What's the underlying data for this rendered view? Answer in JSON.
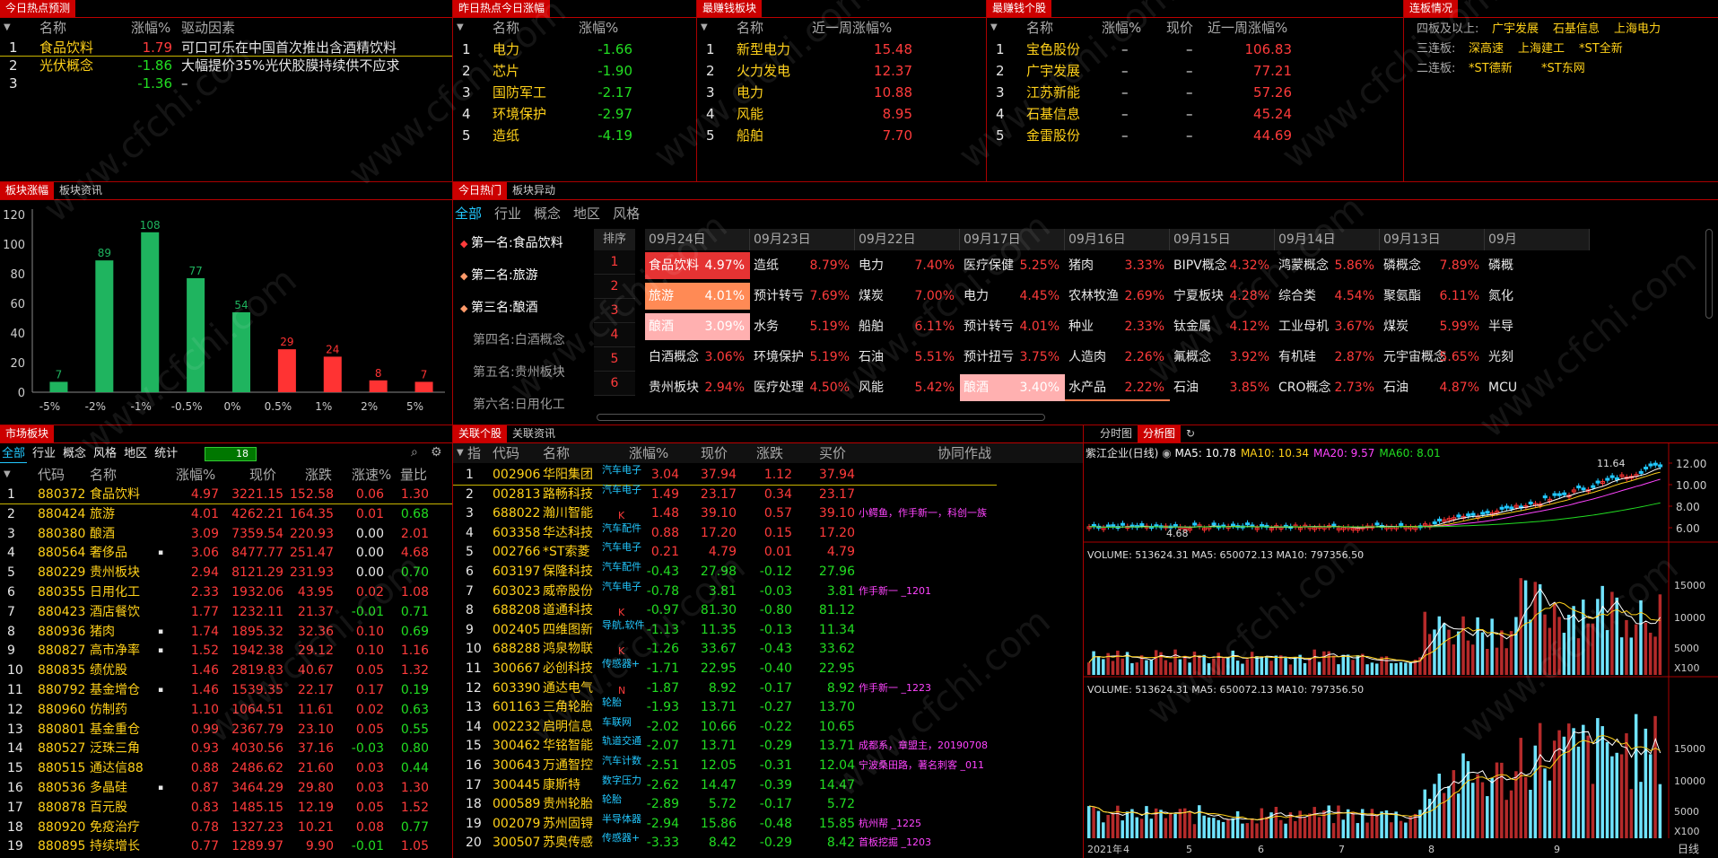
{
  "p1": {
    "tab": "今日热点预测",
    "headers": [
      "名称",
      "涨幅%",
      "驱动因素"
    ],
    "rows": [
      {
        "n": "1",
        "name": "食品饮料",
        "chg": "1.79",
        "reason": "可口可乐在中国首次推出含酒精饮料"
      },
      {
        "n": "2",
        "name": "光伏概念",
        "chg": "-1.86",
        "reason": "大幅提价35%光伏胶膜持续供不应求"
      },
      {
        "n": "3",
        "name": "",
        "chg": "-1.36",
        "reason": "–"
      }
    ]
  },
  "p2": {
    "tab": "昨日热点今日涨幅",
    "headers": [
      "名称",
      "涨幅%"
    ],
    "rows": [
      {
        "n": "1",
        "name": "电力",
        "chg": "-1.66"
      },
      {
        "n": "2",
        "name": "芯片",
        "chg": "-1.90"
      },
      {
        "n": "3",
        "name": "国防军工",
        "chg": "-2.17"
      },
      {
        "n": "4",
        "name": "环境保护",
        "chg": "-2.97"
      },
      {
        "n": "5",
        "name": "造纸",
        "chg": "-4.19"
      }
    ]
  },
  "p3": {
    "tab": "最赚钱板块",
    "headers": [
      "名称",
      "近一周涨幅%"
    ],
    "rows": [
      {
        "n": "1",
        "name": "新型电力",
        "chg": "15.48"
      },
      {
        "n": "2",
        "name": "火力发电",
        "chg": "12.37"
      },
      {
        "n": "3",
        "name": "电力",
        "chg": "10.88"
      },
      {
        "n": "4",
        "name": "风能",
        "chg": "8.95"
      },
      {
        "n": "5",
        "name": "船舶",
        "chg": "7.70"
      }
    ]
  },
  "p4": {
    "tab": "最赚钱个股",
    "headers": [
      "名称",
      "涨幅%",
      "现价",
      "近一周涨幅%"
    ],
    "rows": [
      {
        "n": "1",
        "name": "宝色股份",
        "chg": "–",
        "price": "–",
        "week": "106.83"
      },
      {
        "n": "2",
        "name": "广宇发展",
        "chg": "–",
        "price": "–",
        "week": "77.21"
      },
      {
        "n": "3",
        "name": "江苏新能",
        "chg": "–",
        "price": "–",
        "week": "57.26"
      },
      {
        "n": "4",
        "name": "石基信息",
        "chg": "–",
        "price": "–",
        "week": "45.24"
      },
      {
        "n": "5",
        "name": "金雷股份",
        "chg": "–",
        "price": "–",
        "week": "44.69"
      }
    ]
  },
  "p5": {
    "tab": "连板情况",
    "rows": [
      {
        "label": "四板及以上:",
        "stocks": [
          "广宇发展",
          "石基信息",
          "上海电力"
        ]
      },
      {
        "label": "三连板:",
        "stocks": [
          "深高速",
          "上海建工",
          "*ST全新"
        ]
      },
      {
        "label": "二连板:",
        "stocks": [
          "*ST德新",
          "*ST东网"
        ]
      }
    ]
  },
  "bar": {
    "tabs": [
      "板块涨幅",
      "板块资讯"
    ],
    "chart_data": {
      "type": "bar",
      "categories": [
        "-5%",
        "-2%",
        "-1%",
        "-0.5%",
        "0%",
        "0.5%",
        "1%",
        "2%",
        "5%"
      ],
      "values": [
        7,
        89,
        108,
        77,
        54,
        29,
        24,
        8,
        7
      ],
      "ylim": [
        0,
        120
      ],
      "yticks": [
        "120",
        "100",
        "80",
        "60",
        "40",
        "20",
        "0"
      ],
      "colors": [
        "#1fb45f",
        "#1fb45f",
        "#1fb45f",
        "#1fb45f",
        "#1fb45f",
        "#ff3333",
        "#ff3333",
        "#ff3333",
        "#ff3333"
      ]
    }
  },
  "hot": {
    "tabs": [
      "今日热门",
      "板块异动"
    ],
    "filters": [
      "全部",
      "行业",
      "概念",
      "地区",
      "风格"
    ],
    "ranks": [
      "第一名:食品饮料",
      "第二名:旅游",
      "第三名:酿酒",
      "第四名:白酒概念",
      "第五名:贵州板块",
      "第六名:日用化工"
    ],
    "rankhdr": "排序",
    "rownums": [
      "1",
      "2",
      "3",
      "4",
      "5",
      "6"
    ],
    "cols": [
      {
        "date": "09月24日",
        "items": [
          [
            "食品饮料",
            "4.97%"
          ],
          [
            "旅游",
            "4.01%"
          ],
          [
            "酿酒",
            "3.09%"
          ],
          [
            "白酒概念",
            "3.06%"
          ],
          [
            "贵州板块",
            "2.94%"
          ]
        ]
      },
      {
        "date": "09月23日",
        "items": [
          [
            "造纸",
            "8.79%"
          ],
          [
            "预计转亏",
            "7.69%"
          ],
          [
            "水务",
            "5.19%"
          ],
          [
            "环境保护",
            "5.19%"
          ],
          [
            "医疗处理",
            "4.50%"
          ]
        ]
      },
      {
        "date": "09月22日",
        "items": [
          [
            "电力",
            "7.40%"
          ],
          [
            "煤炭",
            "7.00%"
          ],
          [
            "船舶",
            "6.11%"
          ],
          [
            "石油",
            "5.51%"
          ],
          [
            "风能",
            "5.42%"
          ]
        ]
      },
      {
        "date": "09月17日",
        "items": [
          [
            "医疗保健",
            "5.25%"
          ],
          [
            "电力",
            "4.45%"
          ],
          [
            "预计转亏",
            "4.01%"
          ],
          [
            "预计扭亏",
            "3.75%"
          ],
          [
            "酿酒",
            "3.40%"
          ]
        ]
      },
      {
        "date": "09月16日",
        "items": [
          [
            "猪肉",
            "3.33%"
          ],
          [
            "农林牧渔",
            "2.69%"
          ],
          [
            "种业",
            "2.33%"
          ],
          [
            "人造肉",
            "2.26%"
          ],
          [
            "水产品",
            "2.22%"
          ]
        ]
      },
      {
        "date": "09月15日",
        "items": [
          [
            "BIPV概念",
            "4.32%"
          ],
          [
            "宁夏板块",
            "4.28%"
          ],
          [
            "钛金属",
            "4.12%"
          ],
          [
            "氟概念",
            "3.92%"
          ],
          [
            "石油",
            "3.85%"
          ]
        ]
      },
      {
        "date": "09月14日",
        "items": [
          [
            "鸿蒙概念",
            "5.86%"
          ],
          [
            "综合类",
            "4.54%"
          ],
          [
            "工业母机",
            "3.67%"
          ],
          [
            "有机硅",
            "2.87%"
          ],
          [
            "CRO概念",
            "2.73%"
          ]
        ]
      },
      {
        "date": "09月13日",
        "items": [
          [
            "磷概念",
            "7.89%"
          ],
          [
            "聚氨酯",
            "6.11%"
          ],
          [
            "煤炭",
            "5.99%"
          ],
          [
            "元宇宙概念",
            "5.65%"
          ],
          [
            "石油",
            "4.87%"
          ]
        ]
      },
      {
        "date": "09月",
        "items": [
          [
            "磷概",
            "",
            ""
          ],
          [
            "氮化",
            ""
          ],
          [
            "半导",
            ""
          ],
          [
            "光刻",
            ""
          ],
          [
            "MCU",
            ""
          ]
        ]
      }
    ]
  },
  "mkt": {
    "tabs": [
      "市场板块"
    ],
    "filters": [
      "全部",
      "行业",
      "概念",
      "风格",
      "地区",
      "统计"
    ],
    "count": "18",
    "headers": [
      "代码",
      "名称",
      "涨幅%",
      "现价",
      "涨跌",
      "涨速%",
      "量比"
    ],
    "rows": [
      [
        "1",
        "880372",
        "食品饮料",
        "4.97",
        "3221.15",
        "152.58",
        "0.06",
        "1.30"
      ],
      [
        "2",
        "880424",
        "旅游",
        "4.01",
        "4262.21",
        "164.35",
        "0.01",
        "0.68"
      ],
      [
        "3",
        "880380",
        "酿酒",
        "3.09",
        "7359.54",
        "220.93",
        "0.00",
        "2.01"
      ],
      [
        "4",
        "880564",
        "奢侈品",
        "3.06",
        "8477.77",
        "251.47",
        "0.00",
        "4.68"
      ],
      [
        "5",
        "880229",
        "贵州板块",
        "2.94",
        "8121.29",
        "231.93",
        "0.00",
        "0.70"
      ],
      [
        "6",
        "880355",
        "日用化工",
        "2.33",
        "1932.06",
        "43.95",
        "0.02",
        "1.08"
      ],
      [
        "7",
        "880423",
        "酒店餐饮",
        "1.77",
        "1232.11",
        "21.37",
        "-0.01",
        "0.71"
      ],
      [
        "8",
        "880936",
        "猪肉",
        "1.74",
        "1895.32",
        "32.36",
        "0.10",
        "0.69"
      ],
      [
        "9",
        "880827",
        "高市净率",
        "1.52",
        "1942.38",
        "29.12",
        "0.10",
        "1.16"
      ],
      [
        "10",
        "880835",
        "绩优股",
        "1.46",
        "2819.83",
        "40.67",
        "0.05",
        "1.32"
      ],
      [
        "11",
        "880792",
        "基金增仓",
        "1.46",
        "1539.35",
        "22.17",
        "0.17",
        "0.19"
      ],
      [
        "12",
        "880960",
        "仿制药",
        "1.10",
        "1064.51",
        "11.61",
        "0.02",
        "0.63"
      ],
      [
        "13",
        "880801",
        "基金重仓",
        "0.99",
        "2367.79",
        "23.10",
        "0.05",
        "0.55"
      ],
      [
        "14",
        "880527",
        "泛珠三角",
        "0.93",
        "4030.56",
        "37.16",
        "-0.03",
        "0.80"
      ],
      [
        "15",
        "880515",
        "通达信88",
        "0.88",
        "2486.62",
        "21.60",
        "0.03",
        "0.44"
      ],
      [
        "16",
        "880536",
        "多晶硅",
        "0.87",
        "3464.29",
        "29.80",
        "0.03",
        "1.30"
      ],
      [
        "17",
        "880878",
        "百元股",
        "0.83",
        "1485.15",
        "12.19",
        "0.05",
        "1.52"
      ],
      [
        "18",
        "880920",
        "免疫治疗",
        "0.78",
        "1327.23",
        "10.21",
        "0.08",
        "0.77"
      ],
      [
        "19",
        "880895",
        "持续增长",
        "0.77",
        "1289.97",
        "9.90",
        "-0.01",
        "1.05"
      ]
    ]
  },
  "rel": {
    "tabs": [
      "关联个股",
      "关联资讯"
    ],
    "headers": [
      "指",
      "代码",
      "名称",
      "涨幅%",
      "现价",
      "涨跌",
      "买价",
      "协同作战"
    ],
    "rows": [
      [
        "1",
        "002906",
        "华阳集团",
        "汽车电子",
        "3.04",
        "37.94",
        "1.12",
        "37.94",
        ""
      ],
      [
        "2",
        "002813",
        "路畅科技",
        "汽车电子",
        "1.49",
        "23.17",
        "0.34",
        "23.17",
        ""
      ],
      [
        "3",
        "688022",
        "瀚川智能",
        "K",
        "1.48",
        "39.10",
        "0.57",
        "39.10",
        "小鳄鱼，作手新一，科创一族"
      ],
      [
        "4",
        "603358",
        "华达科技",
        "汽车配件",
        "0.88",
        "17.20",
        "0.15",
        "17.20",
        ""
      ],
      [
        "5",
        "002766",
        "*ST索菱",
        "汽车电子",
        "0.21",
        "4.79",
        "0.01",
        "4.79",
        ""
      ],
      [
        "6",
        "603197",
        "保隆科技",
        "汽车配件",
        "-0.43",
        "27.98",
        "-0.12",
        "27.96",
        ""
      ],
      [
        "7",
        "603023",
        "威帝股份",
        "汽车电子",
        "-0.78",
        "3.81",
        "-0.03",
        "3.81",
        "作手新一  _1201"
      ],
      [
        "8",
        "688208",
        "道通科技",
        "K",
        "-0.97",
        "81.30",
        "-0.80",
        "81.12",
        ""
      ],
      [
        "9",
        "002405",
        "四维图新",
        "导航,软件",
        "-1.13",
        "11.35",
        "-0.13",
        "11.34",
        ""
      ],
      [
        "10",
        "688288",
        "鸿泉物联",
        "K",
        "-1.26",
        "33.67",
        "-0.43",
        "33.62",
        ""
      ],
      [
        "11",
        "300667",
        "必创科技",
        "传感器+",
        "-1.71",
        "22.95",
        "-0.40",
        "22.95",
        ""
      ],
      [
        "12",
        "603390",
        "通达电气",
        "N",
        "-1.87",
        "8.92",
        "-0.17",
        "8.92",
        "作手新一  _1223"
      ],
      [
        "13",
        "601163",
        "三角轮胎",
        "轮胎",
        "-1.93",
        "13.71",
        "-0.27",
        "13.70",
        ""
      ],
      [
        "14",
        "002232",
        "启明信息",
        "车联网",
        "-2.02",
        "10.66",
        "-0.22",
        "10.65",
        ""
      ],
      [
        "15",
        "300462",
        "华铭智能",
        "轨道交通",
        "-2.07",
        "13.71",
        "-0.29",
        "13.71",
        "成都系，章盟主，20190708"
      ],
      [
        "16",
        "300643",
        "万通智控",
        "汽车计数",
        "-2.51",
        "12.05",
        "-0.31",
        "12.04",
        "宁波桑田路，著名刺客  _011"
      ],
      [
        "17",
        "300445",
        "康斯特",
        "数字压力",
        "-2.62",
        "14.47",
        "-0.39",
        "14.47",
        ""
      ],
      [
        "18",
        "000589",
        "贵州轮胎",
        "轮胎",
        "-2.89",
        "5.72",
        "-0.17",
        "5.72",
        ""
      ],
      [
        "19",
        "002079",
        "苏州固锝",
        "半导体器",
        "-2.94",
        "15.86",
        "-0.48",
        "15.85",
        "杭州帮  _1225"
      ],
      [
        "20",
        "300507",
        "苏奥传感",
        "传感器+",
        "-3.33",
        "8.42",
        "-0.29",
        "8.42",
        "首板挖掘  _1203"
      ]
    ]
  },
  "kline": {
    "tabs": [
      "分时图",
      "分析图"
    ],
    "title": "紫江企业(日线)",
    "ma": [
      {
        "label": "MA5: 10.78",
        "color": "#ffffff"
      },
      {
        "label": "MA10: 10.34",
        "color": "#ffd11a"
      },
      {
        "label": "MA20: 9.57",
        "color": "#ff44ff"
      },
      {
        "label": "MA60: 8.01",
        "color": "#22dd22"
      }
    ],
    "yticks": [
      "12.00",
      "10.00",
      "8.00",
      "6.00"
    ],
    "high": "11.64",
    "low": "4.68",
    "vol1": "VOLUME: 513624.31  MA5: 650072.13  MA10: 797356.50",
    "vol2": "VOLUME: 513624.31  MA5: 650072.13  MA10: 797356.50",
    "vticks": [
      "15000",
      "10000",
      "5000"
    ],
    "unit": "X100",
    "xlabels": [
      "2021年",
      "4",
      "5",
      "6",
      "7",
      "8",
      "9"
    ],
    "period": "日线"
  },
  "watermark": "www.cfchi.com"
}
